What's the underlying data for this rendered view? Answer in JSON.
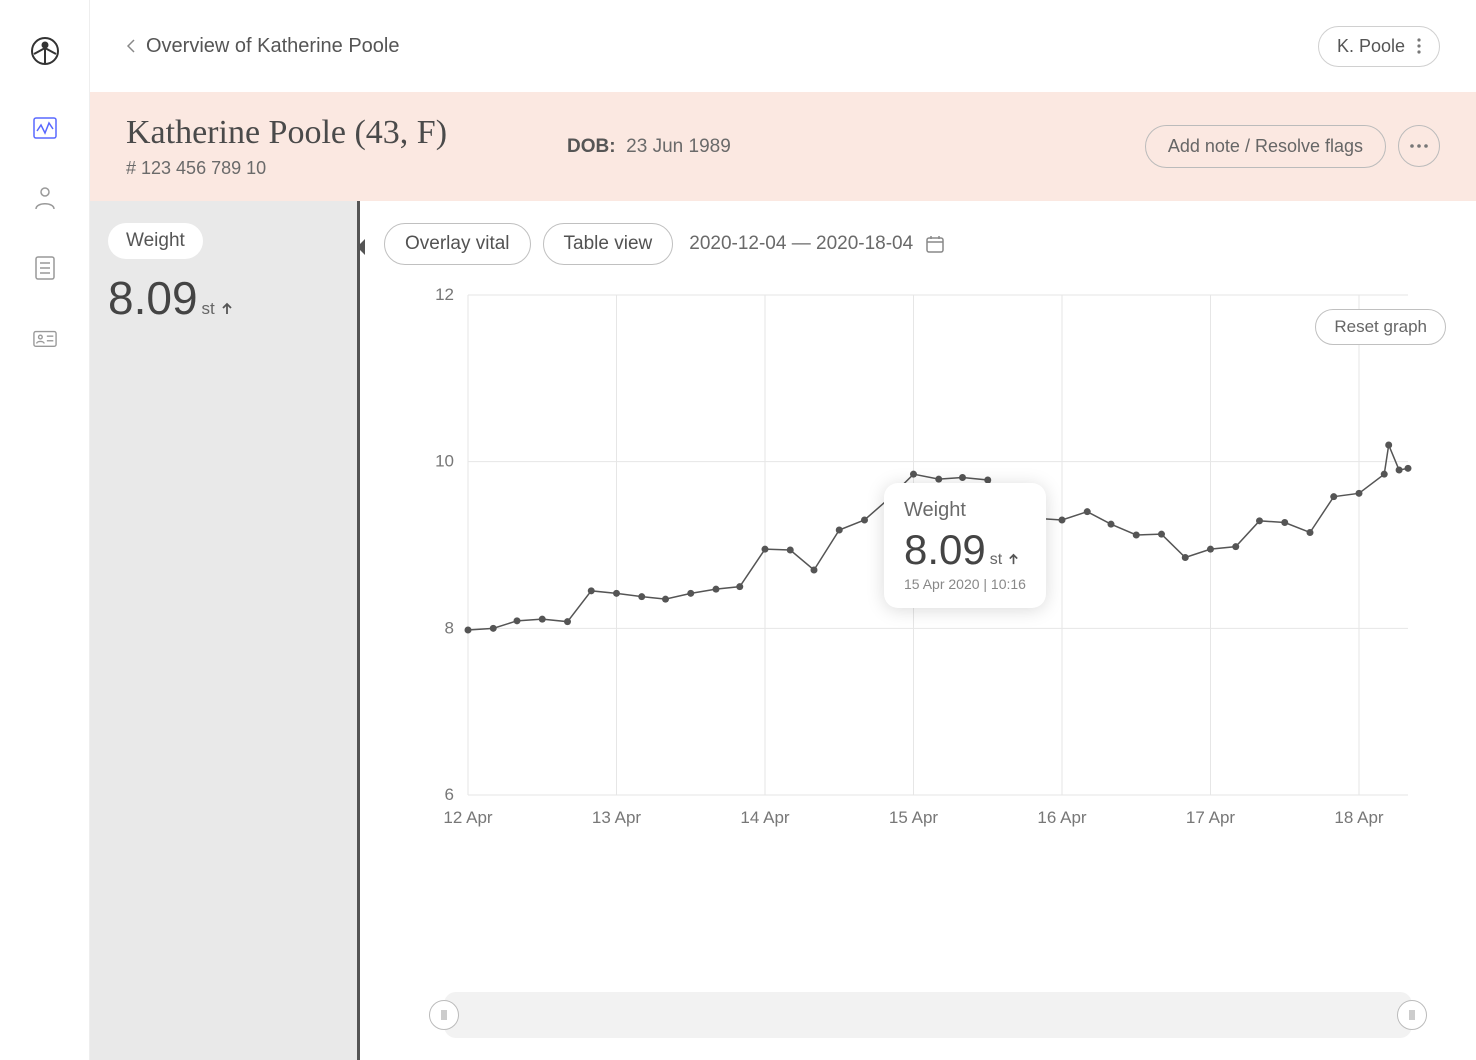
{
  "breadcrumb": {
    "label": "Overview of Katherine Poole"
  },
  "user_chip": {
    "label": "K. Poole"
  },
  "patient": {
    "name": "Katherine Poole (43,  F)",
    "id": "# 123 456 789 10",
    "dob_label": "DOB:",
    "dob": "23 Jun 1989"
  },
  "actions": {
    "add_note": "Add note / Resolve flags"
  },
  "panel": {
    "chip": "Weight",
    "value": "8.09",
    "unit": "st"
  },
  "controls": {
    "overlay": "Overlay vital",
    "table": "Table view",
    "date_range": "2020-12-04 — 2020-18-04",
    "reset": "Reset graph"
  },
  "tooltip": {
    "title": "Weight",
    "value": "8.09",
    "unit": "st",
    "timestamp": "15 Apr 2020 | 10:16"
  },
  "chart_data": {
    "type": "line",
    "title": "Weight",
    "ylabel": "st",
    "xlabel": "",
    "ylim": [
      6,
      12
    ],
    "x_tick_labels": [
      "12 Apr",
      "13 Apr",
      "14 Apr",
      "15 Apr",
      "16 Apr",
      "17 Apr",
      "18 Apr"
    ],
    "y_tick_labels": [
      "6",
      "8",
      "10",
      "12"
    ],
    "x": [
      0.0,
      0.17,
      0.33,
      0.5,
      0.67,
      0.83,
      1.0,
      1.17,
      1.33,
      1.5,
      1.67,
      1.83,
      2.0,
      2.17,
      2.33,
      2.5,
      2.67,
      2.83,
      3.0,
      3.17,
      3.33,
      3.5,
      3.67,
      3.83,
      4.0,
      4.17,
      4.33,
      4.5,
      4.67,
      4.83,
      5.0,
      5.17,
      5.33,
      5.5,
      5.67,
      5.83,
      6.0,
      6.17
    ],
    "values": [
      7.98,
      8.0,
      8.09,
      8.11,
      8.08,
      8.45,
      8.42,
      8.38,
      8.35,
      8.42,
      8.47,
      8.5,
      8.95,
      8.94,
      8.7,
      9.18,
      9.3,
      9.55,
      9.85,
      9.79,
      9.81,
      9.78,
      9.32,
      9.32,
      9.3,
      9.4,
      9.25,
      9.12,
      9.13,
      8.85,
      8.95,
      8.98,
      9.29,
      9.27,
      9.15,
      9.58,
      9.62,
      9.85
    ],
    "extra_x": [
      6.2,
      6.27,
      6.33
    ],
    "extra_values": [
      10.2,
      9.9,
      9.92
    ]
  }
}
